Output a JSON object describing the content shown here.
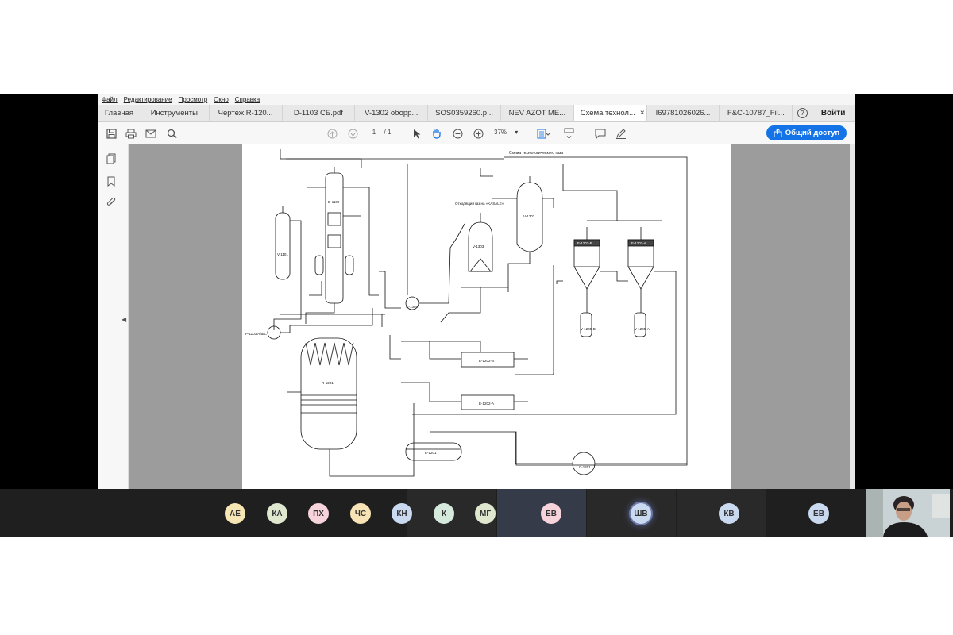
{
  "menu": [
    "Файл",
    "Редактирование",
    "Просмотр",
    "Окно",
    "Справка"
  ],
  "tabs": {
    "home": "Главная",
    "tools": "Инструменты",
    "docs": [
      "Чертеж R-120...",
      "D-1103 СБ.pdf",
      "V-1302 оборр...",
      "SOS0359260.p...",
      "NEV AZOT ME...",
      "Схема технол...",
      "I69781026026...",
      "F&C-10787_Fil..."
    ],
    "active_close": "×",
    "help": "?",
    "login": "Войти"
  },
  "toolbar": {
    "page_current": "1",
    "page_total": "/ 1",
    "zoom": "37%",
    "share_label": "Общий доступ"
  },
  "diagram": {
    "title": "Схема технологического газа",
    "labels": {
      "v1101": "V-1101",
      "d1102": "D-1102",
      "v1303": "V-1303",
      "v1302": "V-1302",
      "p1201b": "F-1201-B",
      "p1201a": "F-1201-A",
      "v1205b": "V-1205-B",
      "v1205a": "V-1205-A",
      "r1201": "R-1201",
      "e1202b": "E-1202-B",
      "e1202a": "E-1202-A",
      "e1201": "E-1201",
      "c1201": "C-1201",
      "p1103": "P-1103 A/B/C",
      "g1301": "G-1301",
      "offgas": "Отходящий газ на «KASALE»"
    }
  },
  "participants": [
    {
      "initials": "АЕ",
      "color": "#f6e6b4"
    },
    {
      "initials": "КА",
      "color": "#dfe8cf"
    },
    {
      "initials": "ПХ",
      "color": "#f7d3dc"
    },
    {
      "initials": "ЧС",
      "color": "#f7e3b5"
    },
    {
      "initials": "КН",
      "color": "#c8d9f0"
    },
    {
      "initials": "К",
      "color": "#d5e9dc"
    },
    {
      "initials": "МГ",
      "color": "#dfe8cf"
    },
    {
      "initials": "ЕВ",
      "color": "#f7d3dc"
    },
    {
      "initials": "ШВ",
      "color": "#c8d9f0"
    },
    {
      "initials": "КВ",
      "color": "#c8d9f0"
    },
    {
      "initials": "ЕВ",
      "color": "#c8d9f0"
    }
  ]
}
